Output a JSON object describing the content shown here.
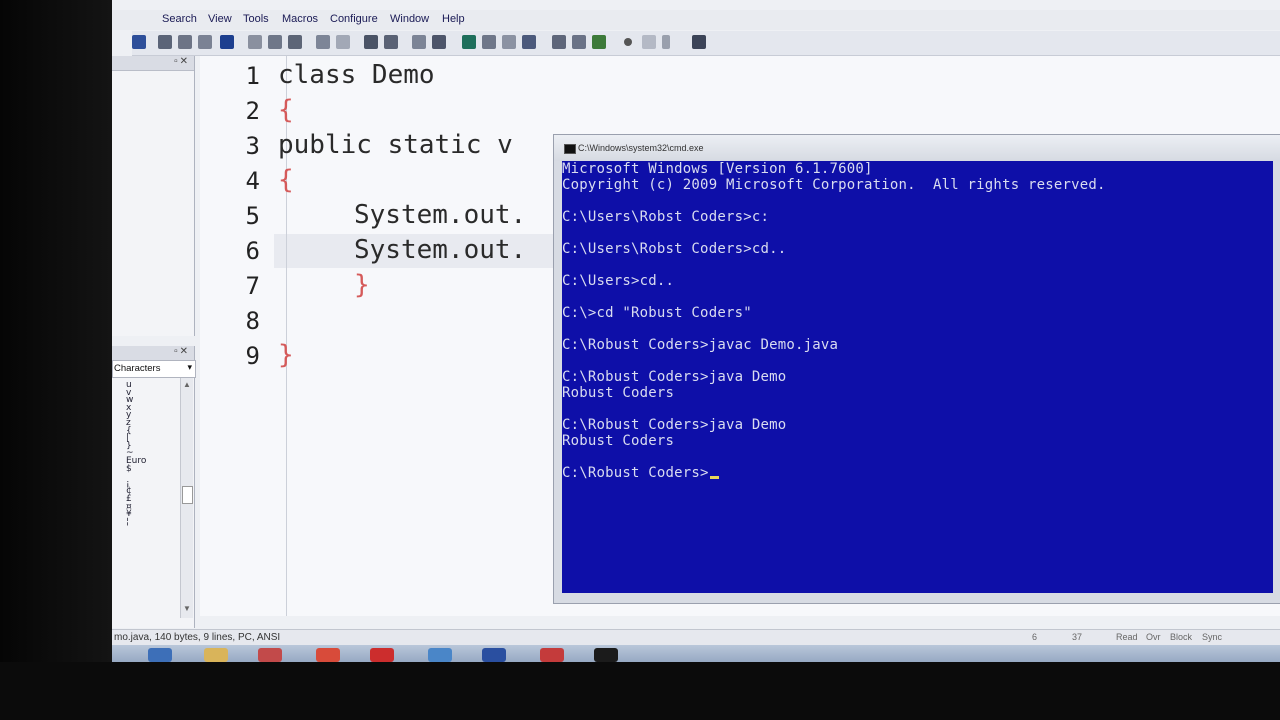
{
  "menu": {
    "items": [
      "Search",
      "View",
      "Tools",
      "Macros",
      "Configure",
      "Window",
      "Help"
    ]
  },
  "characters_panel": {
    "title": "Characters",
    "chars": [
      "u",
      "v",
      "w",
      "x",
      "y",
      "z",
      "{",
      "|",
      "}",
      "~",
      "Euro",
      "$",
      "",
      "¡",
      "¢",
      "£",
      "¤",
      "¥",
      "¦"
    ]
  },
  "editor": {
    "line_numbers": [
      "1",
      "2",
      "3",
      "4",
      "5",
      "6",
      "7",
      "8",
      "9"
    ],
    "lines": {
      "l1": "class Demo",
      "l2": "{",
      "l3": "public static v",
      "l4": "{",
      "l5": "System.out.",
      "l6": "System.out.",
      "l7": "}",
      "l9": "}"
    }
  },
  "cmd": {
    "title": "C:\\Windows\\system32\\cmd.exe",
    "output": [
      "Microsoft Windows [Version 6.1.7600]",
      "Copyright (c) 2009 Microsoft Corporation.  All rights reserved.",
      "C:\\Users\\Robst Coders>c:",
      "C:\\Users\\Robst Coders>cd..",
      "C:\\Users>cd..",
      "C:\\>cd \"Robust Coders\"",
      "C:\\Robust Coders>javac Demo.java",
      "C:\\Robust Coders>java Demo",
      "Robust Coders",
      "C:\\Robust Coders>java Demo",
      "Robust Coders",
      "C:\\Robust Coders>"
    ]
  },
  "statusbar": {
    "file_info": "mo.java, 140 bytes, 9 lines, PC, ANSI",
    "right": [
      "6",
      "37",
      "Read",
      "Ovr",
      "Block",
      "Sync"
    ]
  },
  "colors": {
    "cmd_background": "#0e0fa8",
    "cmd_text": "#d9dcf0",
    "brace": "#d55a5a"
  }
}
